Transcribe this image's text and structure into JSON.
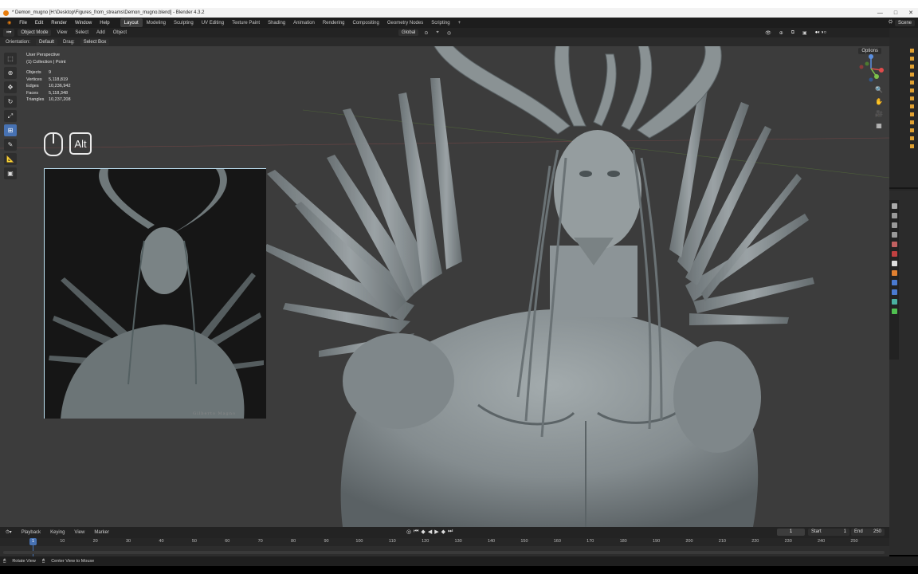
{
  "window": {
    "title": "* Demon_mugno [H:\\Desktop\\Figures_from_streams\\Demon_mugno.blend] - Blender 4.3.2",
    "controls": [
      "—",
      "□",
      "✕"
    ]
  },
  "menu": {
    "items": [
      "File",
      "Edit",
      "Render",
      "Window",
      "Help"
    ],
    "workspaces": [
      "Layout",
      "Modeling",
      "Sculpting",
      "UV Editing",
      "Texture Paint",
      "Shading",
      "Animation",
      "Rendering",
      "Compositing",
      "Geometry Nodes",
      "Scripting"
    ],
    "active_workspace": "Layout",
    "add_tab": "+",
    "scene": "Scene"
  },
  "header": {
    "mode": "Object Mode",
    "items": [
      "View",
      "Select",
      "Add",
      "Object"
    ],
    "transform": "Global",
    "options": "Options"
  },
  "toolheader": {
    "orientation_label": "Orientation:",
    "orientation_value": "Default",
    "drag_label": "Drag:",
    "drag_value": "Select Box"
  },
  "overlay": {
    "perspective": "User Perspective",
    "collection": "(1) Collection | Point",
    "stats": [
      {
        "k": "Objects",
        "v": "9"
      },
      {
        "k": "Vertices",
        "v": "5,118,819"
      },
      {
        "k": "Edges",
        "v": "10,236,942"
      },
      {
        "k": "Faces",
        "v": "5,118,348"
      },
      {
        "k": "Triangles",
        "v": "10,237,208"
      }
    ]
  },
  "keys": {
    "alt": "Alt"
  },
  "reference": {
    "signature": "Gilberto Magno"
  },
  "timeline": {
    "menu": [
      "Playback",
      "Keying",
      "View",
      "Marker"
    ],
    "current_frame": "1",
    "start_label": "Start",
    "start": "1",
    "end_label": "End",
    "end": "250",
    "ticks": [
      "1",
      "10",
      "20",
      "30",
      "40",
      "50",
      "60",
      "70",
      "80",
      "90",
      "100",
      "110",
      "120",
      "130",
      "140",
      "150",
      "160",
      "170",
      "180",
      "190",
      "200",
      "210",
      "220",
      "230",
      "240",
      "250"
    ]
  },
  "status": {
    "items": [
      "Rotate View",
      "Center View to Mouse"
    ]
  },
  "colors": {
    "accent": "#4772b3",
    "viewport_bg": "#3c3c3c",
    "model": "#8e9699"
  }
}
